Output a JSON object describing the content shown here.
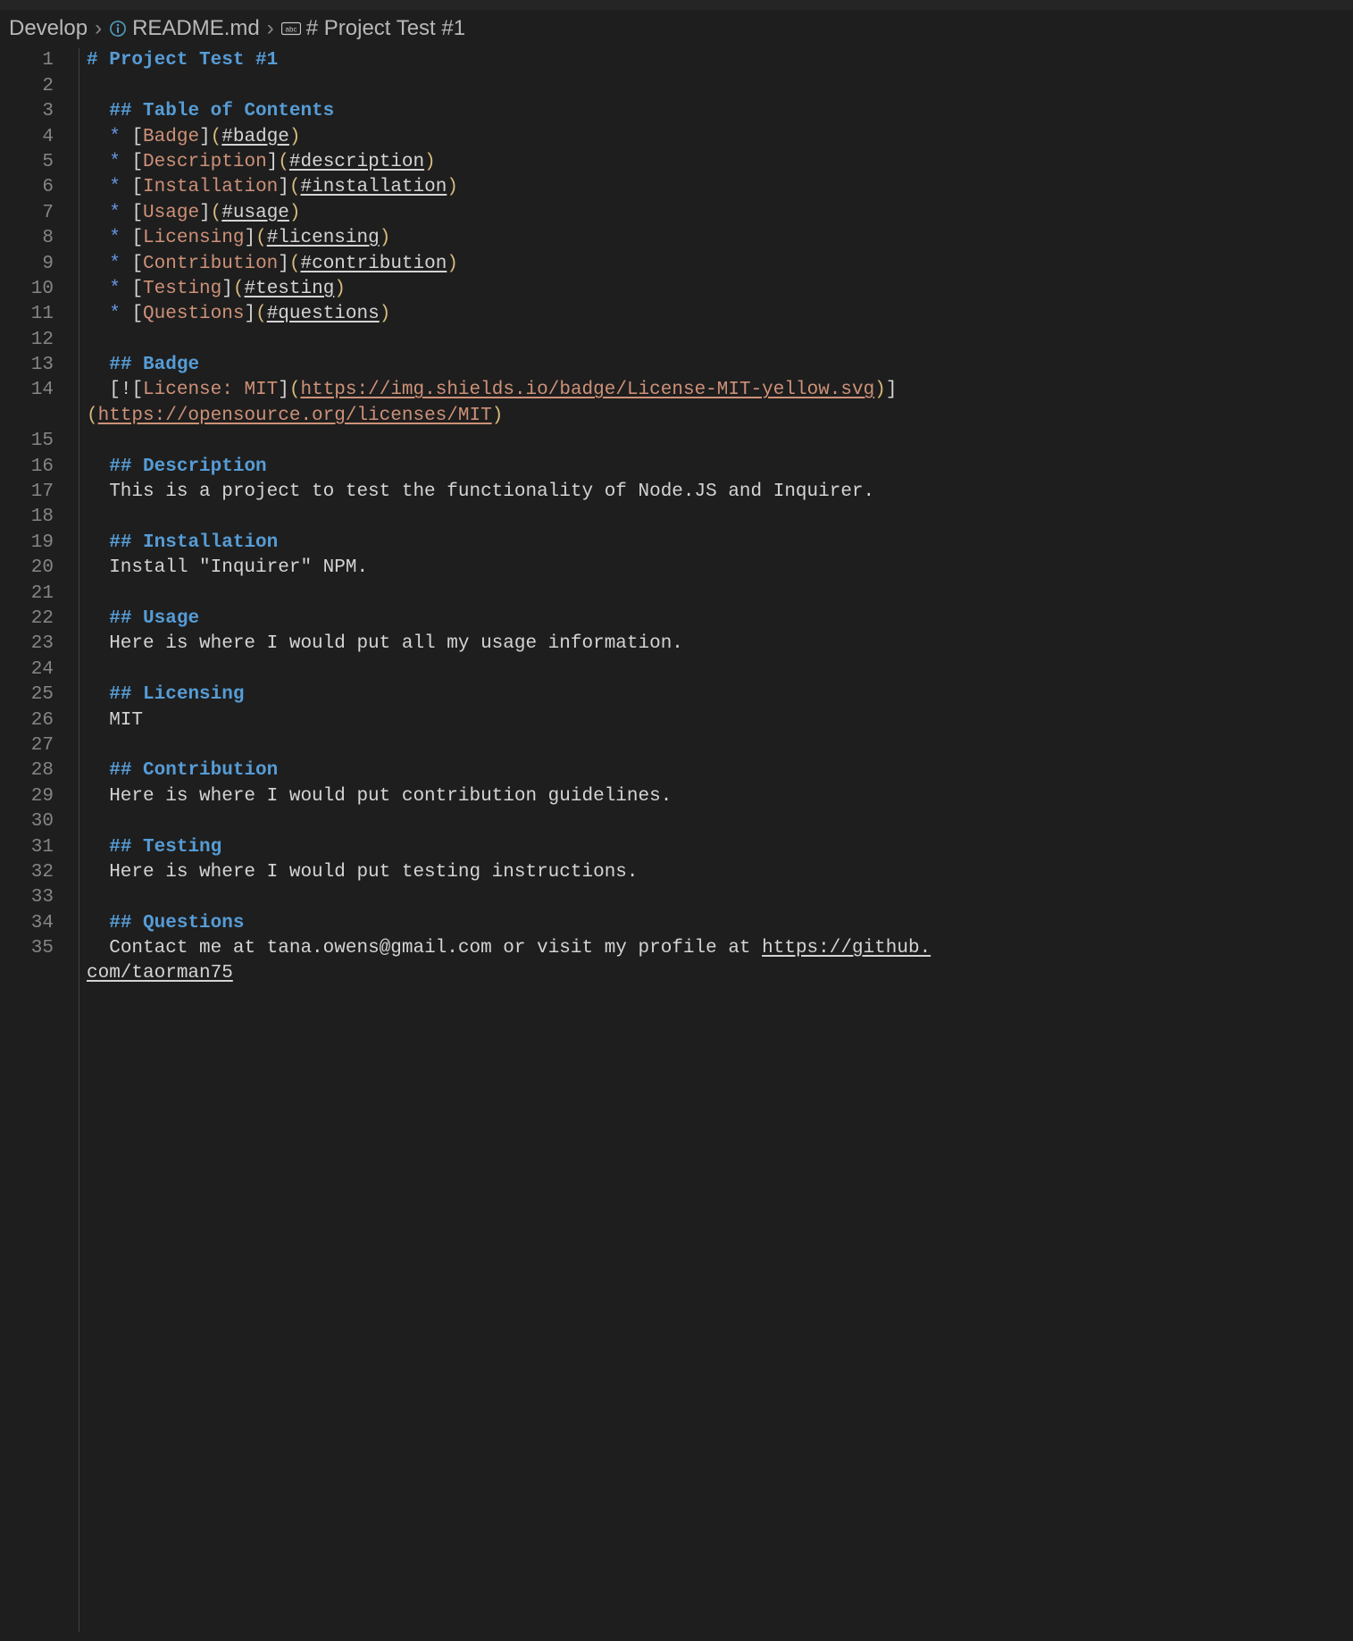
{
  "breadcrumb": {
    "folder": "Develop",
    "file": "README.md",
    "symbol": "# Project Test #1"
  },
  "lines": [
    {
      "n": 1,
      "t": "h1",
      "hash": "#",
      "text": " Project Test #1"
    },
    {
      "n": 2,
      "t": "blank"
    },
    {
      "n": 3,
      "t": "h2",
      "hash": "##",
      "text": " Table of Contents",
      "indent": "  "
    },
    {
      "n": 4,
      "t": "li",
      "label": "Badge",
      "anchor": "#badge"
    },
    {
      "n": 5,
      "t": "li",
      "label": "Description",
      "anchor": "#description"
    },
    {
      "n": 6,
      "t": "li",
      "label": "Installation",
      "anchor": "#installation"
    },
    {
      "n": 7,
      "t": "li",
      "label": "Usage",
      "anchor": "#usage"
    },
    {
      "n": 8,
      "t": "li",
      "label": "Licensing",
      "anchor": "#licensing"
    },
    {
      "n": 9,
      "t": "li",
      "label": "Contribution",
      "anchor": "#contribution"
    },
    {
      "n": 10,
      "t": "li",
      "label": "Testing",
      "anchor": "#testing"
    },
    {
      "n": 11,
      "t": "li",
      "label": "Questions",
      "anchor": "#questions"
    },
    {
      "n": 12,
      "t": "blank"
    },
    {
      "n": 13,
      "t": "h2",
      "hash": "##",
      "text": " Badge",
      "indent": "  "
    },
    {
      "n": 14,
      "t": "badge",
      "pre": "  [",
      "bang": "!",
      "l1": "[",
      "alt": "License: MIT",
      "r1": "]",
      "p1": "(",
      "url1": "https://img.shields.io/badge/License-MIT-yellow.svg",
      "p2": ")",
      "r2": "]",
      "wrapPre": "(",
      "url2": "https://opensource.org/licenses/MIT",
      "p3": ")"
    },
    {
      "n": 15,
      "t": "blank"
    },
    {
      "n": 16,
      "t": "h2",
      "hash": "##",
      "text": " Description",
      "indent": "  "
    },
    {
      "n": 17,
      "t": "txt",
      "text": "  This is a project to test the functionality of Node.JS and Inquirer."
    },
    {
      "n": 18,
      "t": "blank"
    },
    {
      "n": 19,
      "t": "h2",
      "hash": "##",
      "text": " Installation",
      "indent": "  "
    },
    {
      "n": 20,
      "t": "txt",
      "text": "  Install \"Inquirer\" NPM."
    },
    {
      "n": 21,
      "t": "blank"
    },
    {
      "n": 22,
      "t": "h2",
      "hash": "##",
      "text": " Usage",
      "indent": "  "
    },
    {
      "n": 23,
      "t": "txt",
      "text": "  Here is where I would put all my usage information."
    },
    {
      "n": 24,
      "t": "blank"
    },
    {
      "n": 25,
      "t": "h2",
      "hash": "##",
      "text": " Licensing",
      "indent": "  "
    },
    {
      "n": 26,
      "t": "txt",
      "text": "  MIT"
    },
    {
      "n": 27,
      "t": "blank"
    },
    {
      "n": 28,
      "t": "h2",
      "hash": "##",
      "text": " Contribution",
      "indent": "  "
    },
    {
      "n": 29,
      "t": "txt",
      "text": "  Here is where I would put contribution guidelines."
    },
    {
      "n": 30,
      "t": "blank"
    },
    {
      "n": 31,
      "t": "h2",
      "hash": "##",
      "text": " Testing",
      "indent": "  "
    },
    {
      "n": 32,
      "t": "txt",
      "text": "  Here is where I would put testing instructions."
    },
    {
      "n": 33,
      "t": "blank"
    },
    {
      "n": 34,
      "t": "h2",
      "hash": "##",
      "text": " Questions",
      "indent": "  "
    },
    {
      "n": 35,
      "t": "contact",
      "pre": "  Contact me at tana.owens@gmail.com or visit my profile at ",
      "url_a": "https://github.",
      "url_b": "com/taorman75"
    }
  ]
}
